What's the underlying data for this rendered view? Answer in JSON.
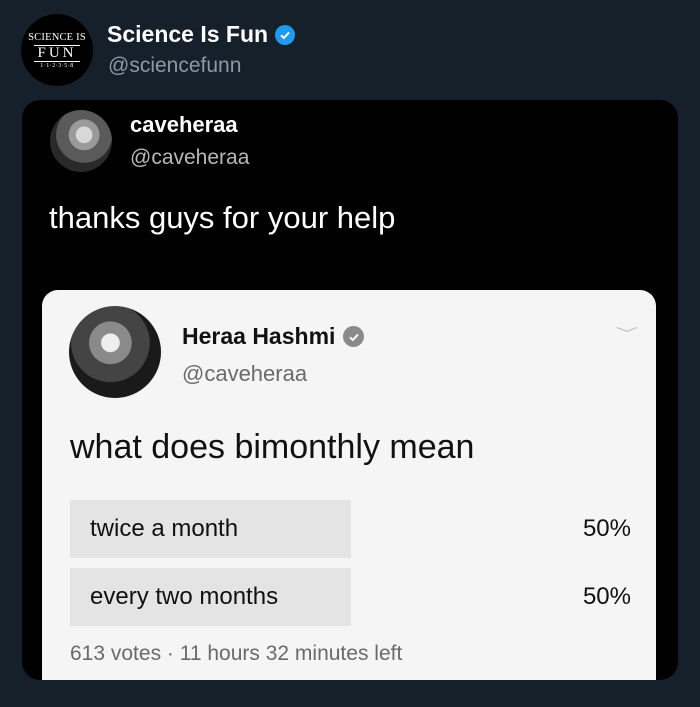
{
  "outer": {
    "avatar_logo": [
      "SCIENCE IS",
      "FUN",
      "1-1-2-3-5-8"
    ],
    "name": "Science Is Fun",
    "handle": "@sciencefunn"
  },
  "inner": {
    "name": "caveheraa",
    "handle": "@caveheraa",
    "text": "thanks guys for your help"
  },
  "poll": {
    "name": "Heraa Hashmi",
    "handle": "@caveheraa",
    "question": "what does bimonthly mean",
    "options": [
      {
        "label": "twice a month",
        "percent": "50%",
        "share": 0.5
      },
      {
        "label": "every two months",
        "percent": "50%",
        "share": 0.5
      }
    ],
    "footer": "613 votes · 11 hours 32 minutes left"
  },
  "colors": {
    "background": "#15202b",
    "verified_blue": "#1d9bf0",
    "poll_bar": "#e4e4e4"
  }
}
